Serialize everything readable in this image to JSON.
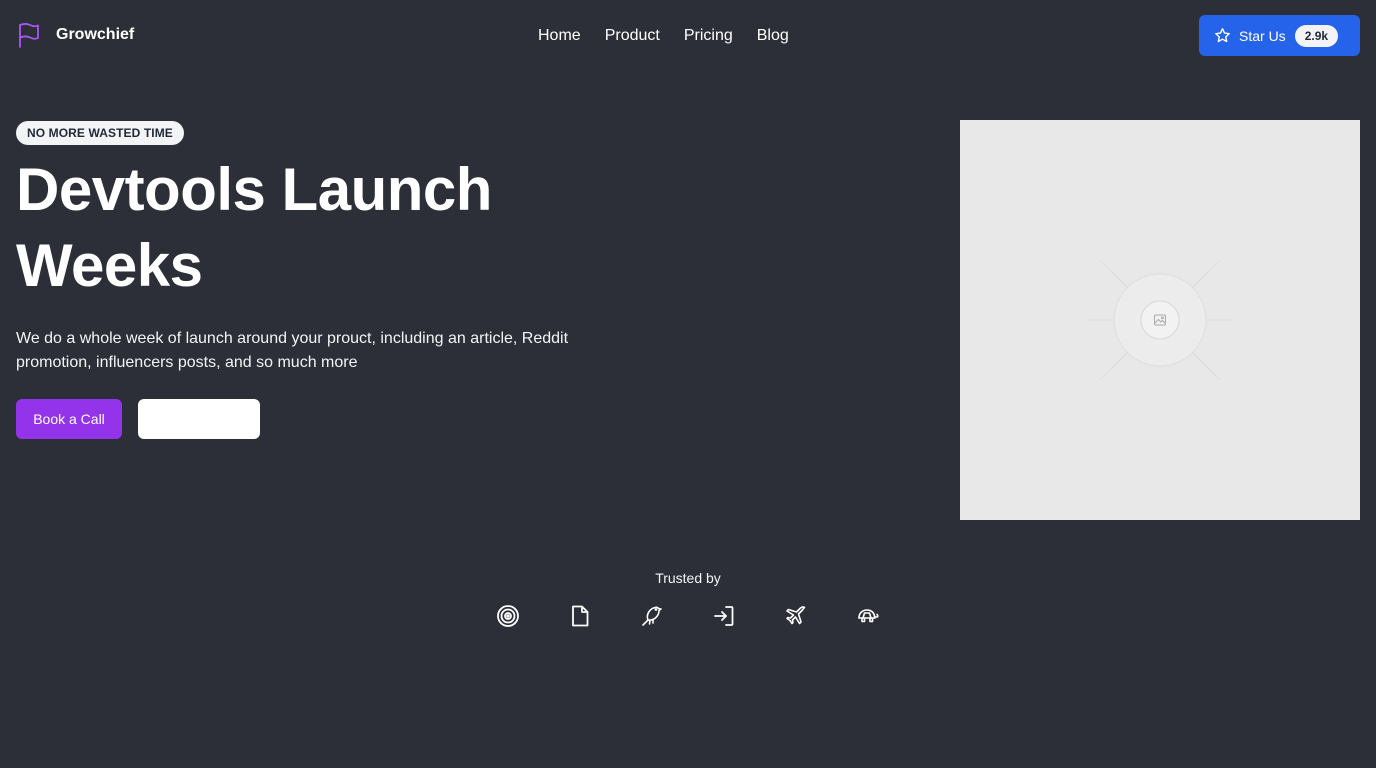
{
  "header": {
    "brand_name": "Growchief",
    "brand_icon": "flag-icon",
    "brand_color": "#a855f7",
    "nav": [
      {
        "label": "Home"
      },
      {
        "label": "Product"
      },
      {
        "label": "Pricing"
      },
      {
        "label": "Blog"
      }
    ],
    "star_button": {
      "label": "Star Us",
      "count": "2.9k",
      "icon": "star-icon",
      "color": "#2563eb"
    }
  },
  "hero": {
    "badge": "NO MORE WASTED TIME",
    "headline": "Devtools Launch Weeks",
    "subtext": "We do a whole week of launch around your prouct, including an article, Reddit promotion, influencers posts, and so much more",
    "primary_button": {
      "label": "Book a Call",
      "color": "#9333ea"
    },
    "secondary_button": {
      "label": ""
    },
    "image_icon": "image-placeholder-icon"
  },
  "trusted": {
    "label": "Trusted by",
    "logos": [
      {
        "icon": "target-icon"
      },
      {
        "icon": "document-icon"
      },
      {
        "icon": "bird-icon"
      },
      {
        "icon": "sign-in-icon"
      },
      {
        "icon": "airplane-icon"
      },
      {
        "icon": "turtle-icon"
      }
    ]
  },
  "colors": {
    "background": "#2c2f37",
    "text": "#ffffff",
    "image_placeholder": "#e8e8e8"
  }
}
